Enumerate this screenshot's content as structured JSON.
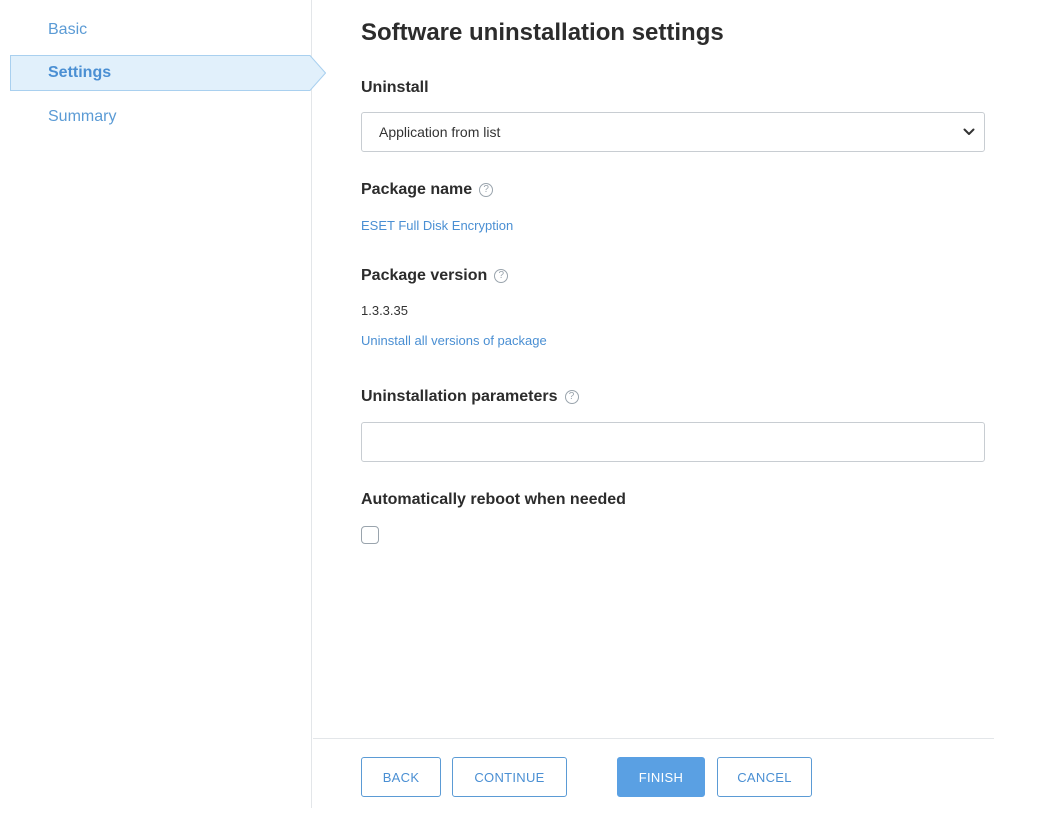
{
  "sidebar": {
    "items": [
      {
        "label": "Basic"
      },
      {
        "label": "Settings"
      },
      {
        "label": "Summary"
      }
    ]
  },
  "main": {
    "title": "Software uninstallation settings",
    "uninstall": {
      "label": "Uninstall",
      "selected": "Application from list"
    },
    "package_name": {
      "label": "Package name",
      "value": "ESET Full Disk Encryption"
    },
    "package_version": {
      "label": "Package version",
      "value": "1.3.3.35",
      "link": "Uninstall all versions of package"
    },
    "uninstall_params": {
      "label": "Uninstallation parameters",
      "value": ""
    },
    "auto_reboot": {
      "label": "Automatically reboot when needed",
      "checked": false
    },
    "help_glyph": "?"
  },
  "footer": {
    "back": "BACK",
    "continue": "CONTINUE",
    "finish": "FINISH",
    "cancel": "CANCEL"
  },
  "colors": {
    "accent": "#4a8fd3",
    "primary_button": "#5aa0e3",
    "active_nav_bg": "#e1f0fb"
  }
}
